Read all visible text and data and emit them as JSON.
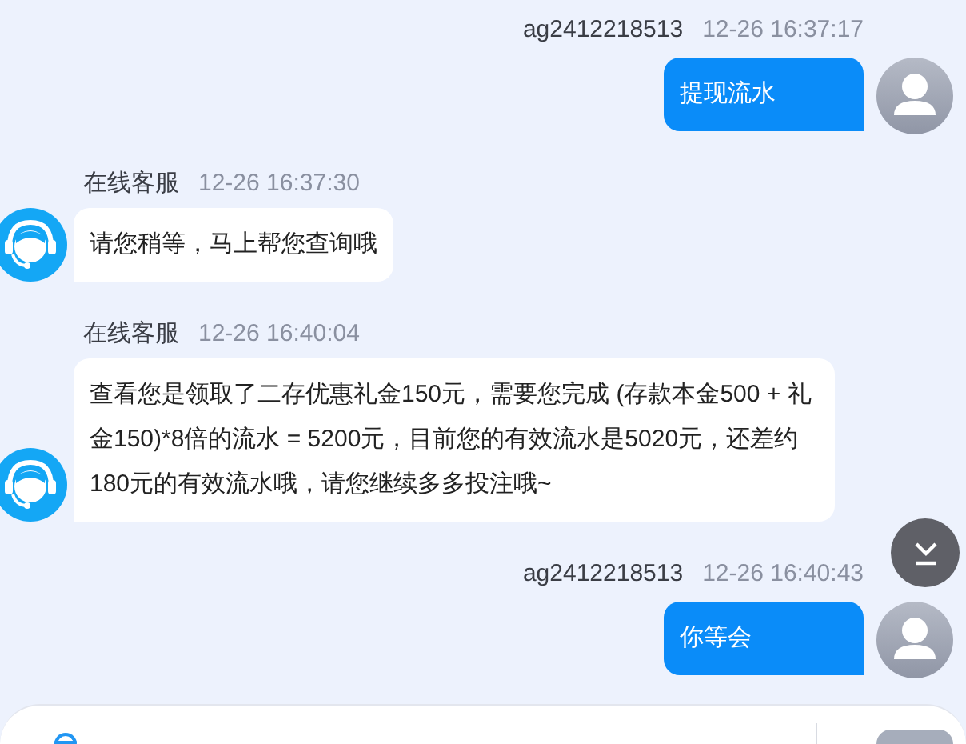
{
  "messages": [
    {
      "kind": "sent",
      "sender": "ag2412218513",
      "time": "12-26 16:37:17",
      "text": "提现流水"
    },
    {
      "kind": "received",
      "sender": "在线客服",
      "time": "12-26 16:37:30",
      "text": "请您稍等，马上帮您查询哦"
    },
    {
      "kind": "received",
      "sender": "在线客服",
      "time": "12-26 16:40:04",
      "text": "查看您是领取了二存优惠礼金150元，需要您完成 (存款本金500 + 礼金150)*8倍的流水 = 5200元，目前您的有效流水是5020元，还差约 180元的有效流水哦，请您继续多多投注哦~"
    },
    {
      "kind": "sent",
      "sender": "ag2412218513",
      "time": "12-26 16:40:43",
      "text": "你等会"
    }
  ]
}
